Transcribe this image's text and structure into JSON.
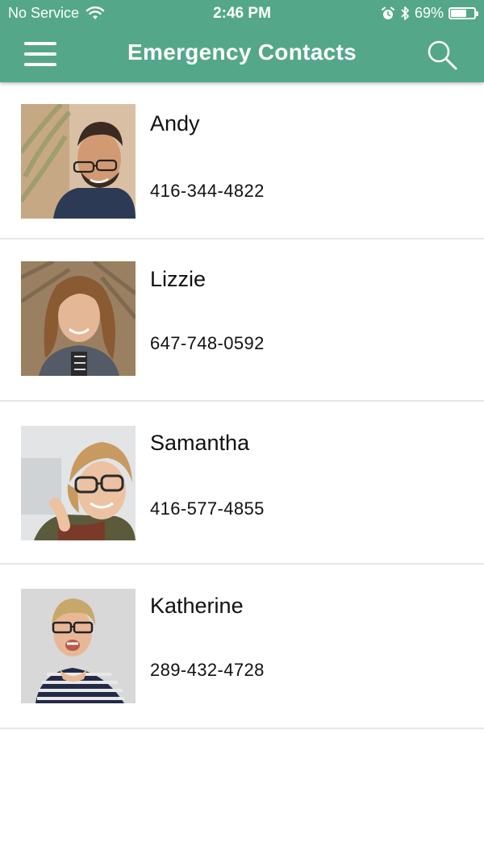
{
  "status_bar": {
    "carrier": "No Service",
    "time": "2:46 PM",
    "battery_percent": "69%",
    "battery_level": 0.69,
    "icons": [
      "wifi-icon",
      "alarm-icon",
      "bluetooth-icon",
      "battery-icon"
    ]
  },
  "nav": {
    "title": "Emergency Contacts",
    "menu_icon": "hamburger-menu-icon",
    "search_icon": "search-icon"
  },
  "colors": {
    "header_bg": "#55a78a",
    "divider": "#e6e6e6",
    "text": "#111111"
  },
  "contacts": [
    {
      "name": "Andy",
      "phone": "416-344-4822",
      "photo": "avatar-photo"
    },
    {
      "name": "Lizzie",
      "phone": "647-748-0592",
      "photo": "avatar-photo"
    },
    {
      "name": "Samantha",
      "phone": "416-577-4855",
      "photo": "avatar-photo"
    },
    {
      "name": "Katherine",
      "phone": "289-432-4728",
      "photo": "avatar-photo"
    }
  ]
}
